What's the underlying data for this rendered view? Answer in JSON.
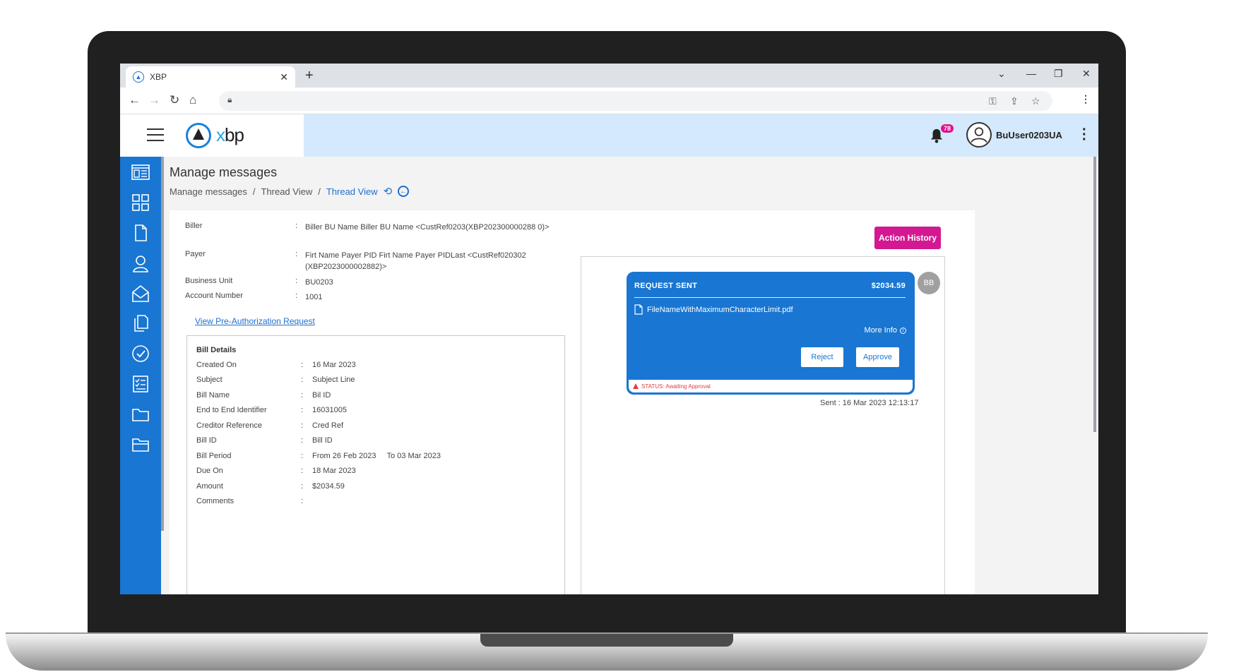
{
  "browser": {
    "tab_title": "XBP",
    "tab_close": "✕",
    "new_tab": "+"
  },
  "app": {
    "logo_text_x": "x",
    "logo_text_bp": "bp",
    "notification_count": "78",
    "username": "BuUser0203UA"
  },
  "page": {
    "title": "Manage messages",
    "breadcrumb": [
      "Manage messages",
      "/",
      "Thread View",
      "/",
      "Thread View"
    ]
  },
  "details": {
    "biller_label": "Biller",
    "biller_value": "Biller BU Name Biller BU Name <CustRef0203(XBP202300000288 0)>",
    "payer_label": "Payer",
    "payer_value": "Firt Name Payer PID Firt Name Payer PIDLast <CustRef020302 (XBP2023000002882)>",
    "bu_label": "Business Unit",
    "bu_value": "BU0203",
    "account_label": "Account Number",
    "account_value": "1001",
    "colon": ":"
  },
  "preauth_link": "View Pre-Authorization Request",
  "bill": {
    "title": "Bill Details",
    "rows": [
      {
        "label": "Created On",
        "value": "16 Mar 2023"
      },
      {
        "label": "Subject",
        "value": "Subject Line"
      },
      {
        "label": "Bill Name",
        "value": "Bil ID"
      },
      {
        "label": "End to End Identifier",
        "value": "16031005"
      },
      {
        "label": "Creditor Reference",
        "value": "Cred Ref"
      },
      {
        "label": "Bill ID",
        "value": "Bill ID"
      },
      {
        "label": "Bill Period",
        "value": "From 26 Feb 2023     To 03 Mar 2023"
      },
      {
        "label": "Due On",
        "value": "18 Mar 2023"
      },
      {
        "label": "Amount",
        "value": "$2034.59"
      },
      {
        "label": "Comments",
        "value": ""
      }
    ]
  },
  "action_history": "Action History",
  "message": {
    "status_title": "REQUEST SENT",
    "amount": "$2034.59",
    "file_name": "FileNameWithMaximumCharacterLimit.pdf",
    "more_info": "More Info",
    "reject": "Reject",
    "approve": "Approve",
    "status_text": "STATUS: Awaiting Approval",
    "avatar_initials": "BB",
    "sent": "Sent : 16 Mar 2023 12:13:17"
  },
  "colors": {
    "sidebar": "#1976d2",
    "accent": "#1e6fd0",
    "action_button": "#d31892",
    "badge": "#e0128c",
    "header_bg": "#d4e9fb"
  }
}
